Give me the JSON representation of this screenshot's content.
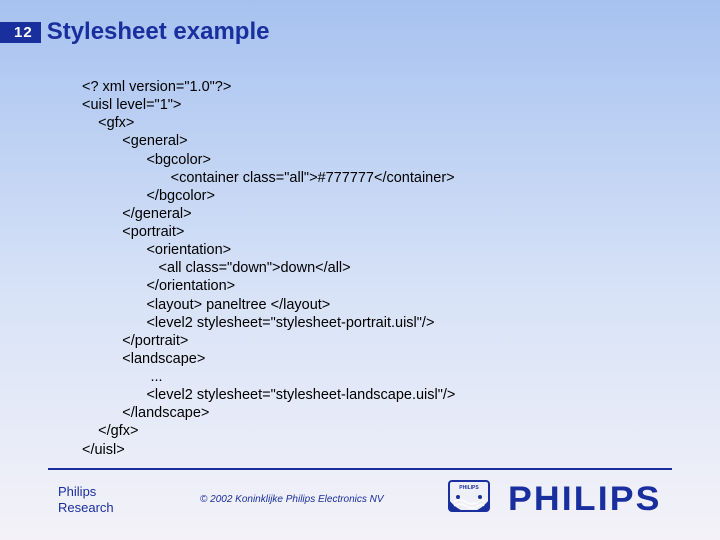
{
  "slide_number": "12",
  "title": "Stylesheet example",
  "code": "<? xml version=\"1.0\"?>\n<uisl level=\"1\">\n    <gfx>\n          <general>\n                <bgcolor>\n                      <container class=\"all\">#777777</container>\n                </bgcolor>\n          </general>\n          <portrait>\n                <orientation>\n                   <all class=\"down\">down</all>\n                </orientation>\n                <layout> paneltree </layout>\n                <level2 stylesheet=\"stylesheet-portrait.uisl\"/>\n          </portrait>\n          <landscape>\n                 ...\n                <level2 stylesheet=\"stylesheet-landscape.uisl\"/>\n          </landscape>\n    </gfx>\n</uisl>",
  "footer": {
    "org_line1": "Philips",
    "org_line2": "Research",
    "copyright": "© 2002 Koninklijke Philips Electronics NV",
    "wordmark": "PHILIPS"
  }
}
